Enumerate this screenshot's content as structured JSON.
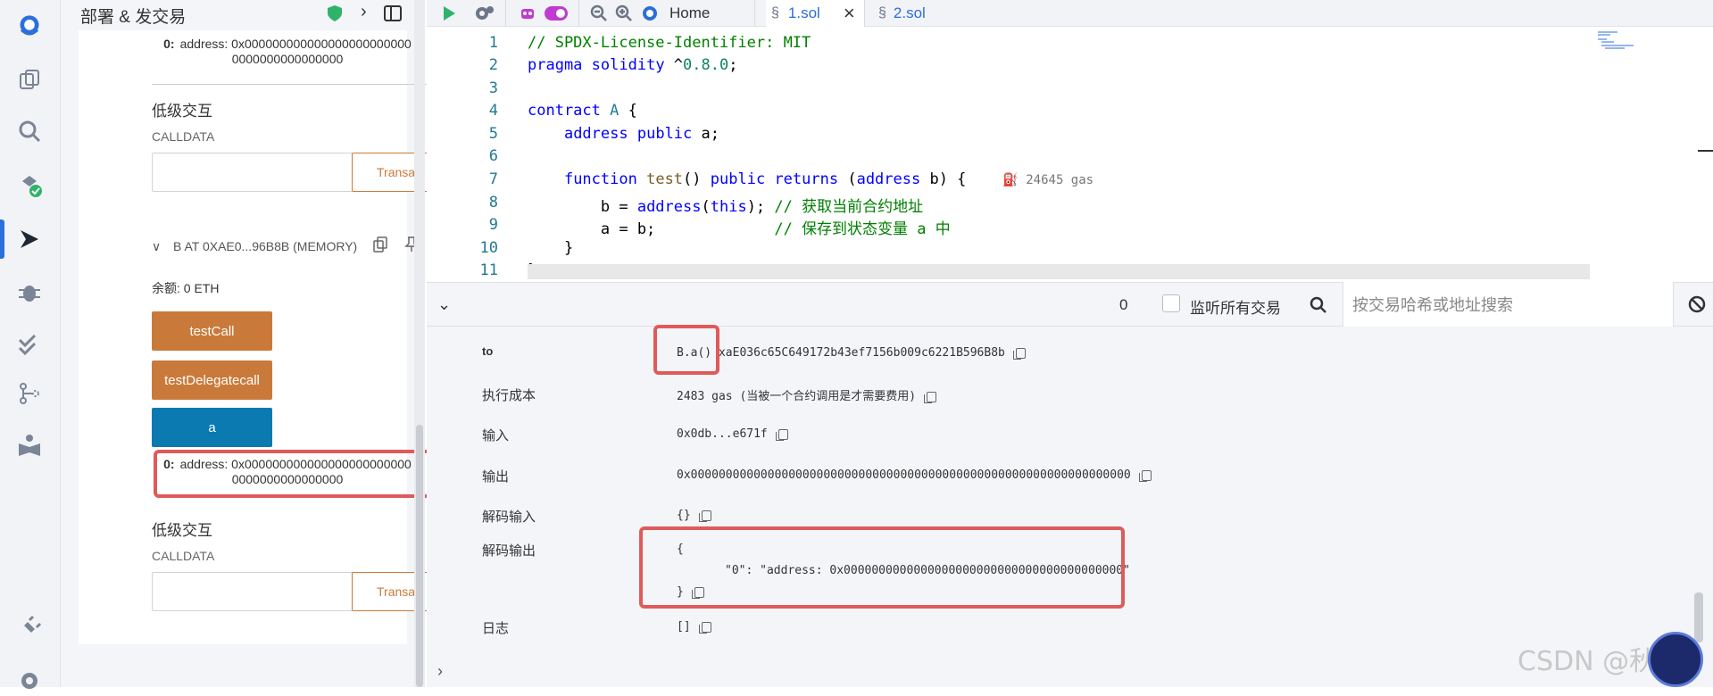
{
  "panel": {
    "title": "部署 & 发交易",
    "top_output": {
      "index": "0:",
      "line1": "address: 0x000000000000000000000000",
      "line2": "0000000000000000"
    },
    "low_level_1": {
      "title": "低级交互",
      "calldata_label": "CALLDATA",
      "transact_label": "Transact"
    },
    "instance": {
      "label": "B AT 0XAE0...96B8B (MEMORY)",
      "balance": "余额: 0 ETH"
    },
    "buttons": {
      "testCall": "testCall",
      "testDelegatecall": "testDelegatecall",
      "a": "a"
    },
    "a_output": {
      "index": "0:",
      "line1": "address: 0x000000000000000000000000",
      "line2": "0000000000000000"
    },
    "low_level_2": {
      "title": "低级交互",
      "calldata_label": "CALLDATA",
      "transact_label": "Transact"
    }
  },
  "tabs": {
    "home": "Home",
    "file1": "1.sol",
    "file2": "2.sol"
  },
  "editor": {
    "line_numbers": [
      "1",
      "2",
      "3",
      "4",
      "5",
      "6",
      "7",
      "8",
      "9",
      "10",
      "11"
    ],
    "gas_hint": "24645 gas"
  },
  "terminal": {
    "count": "0",
    "listen_all_label": "监听所有交易",
    "search_placeholder": "按交易哈希或地址搜索",
    "rows": {
      "to_key": "to",
      "to_func": "B.a()",
      "to_addr": "xaE036c65C649172b43ef7156b009c6221B596B8b",
      "cost_key": "执行成本",
      "cost_val": "2483 gas (当被一个合约调用是才需要费用)",
      "input_key": "输入",
      "input_val": "0x0db...e671f",
      "output_key": "输出",
      "output_val": "0x000000000000000000000000000000000000000000000000000000000000000",
      "decoded_input_key": "解码输入",
      "decoded_input_val": "{}",
      "decoded_output_key": "解码输出",
      "decoded_output_open": "{",
      "decoded_output_body": "\"0\": \"address: 0x0000000000000000000000000000000000000000\"",
      "decoded_output_close": "}",
      "logs_key": "日志",
      "logs_val": "[]"
    }
  },
  "watermark": "CSDN @秋说",
  "colors": {
    "accent_orange": "#c97a3a",
    "accent_blue": "#0a7ab0",
    "highlight_red": "#e05a5a"
  }
}
